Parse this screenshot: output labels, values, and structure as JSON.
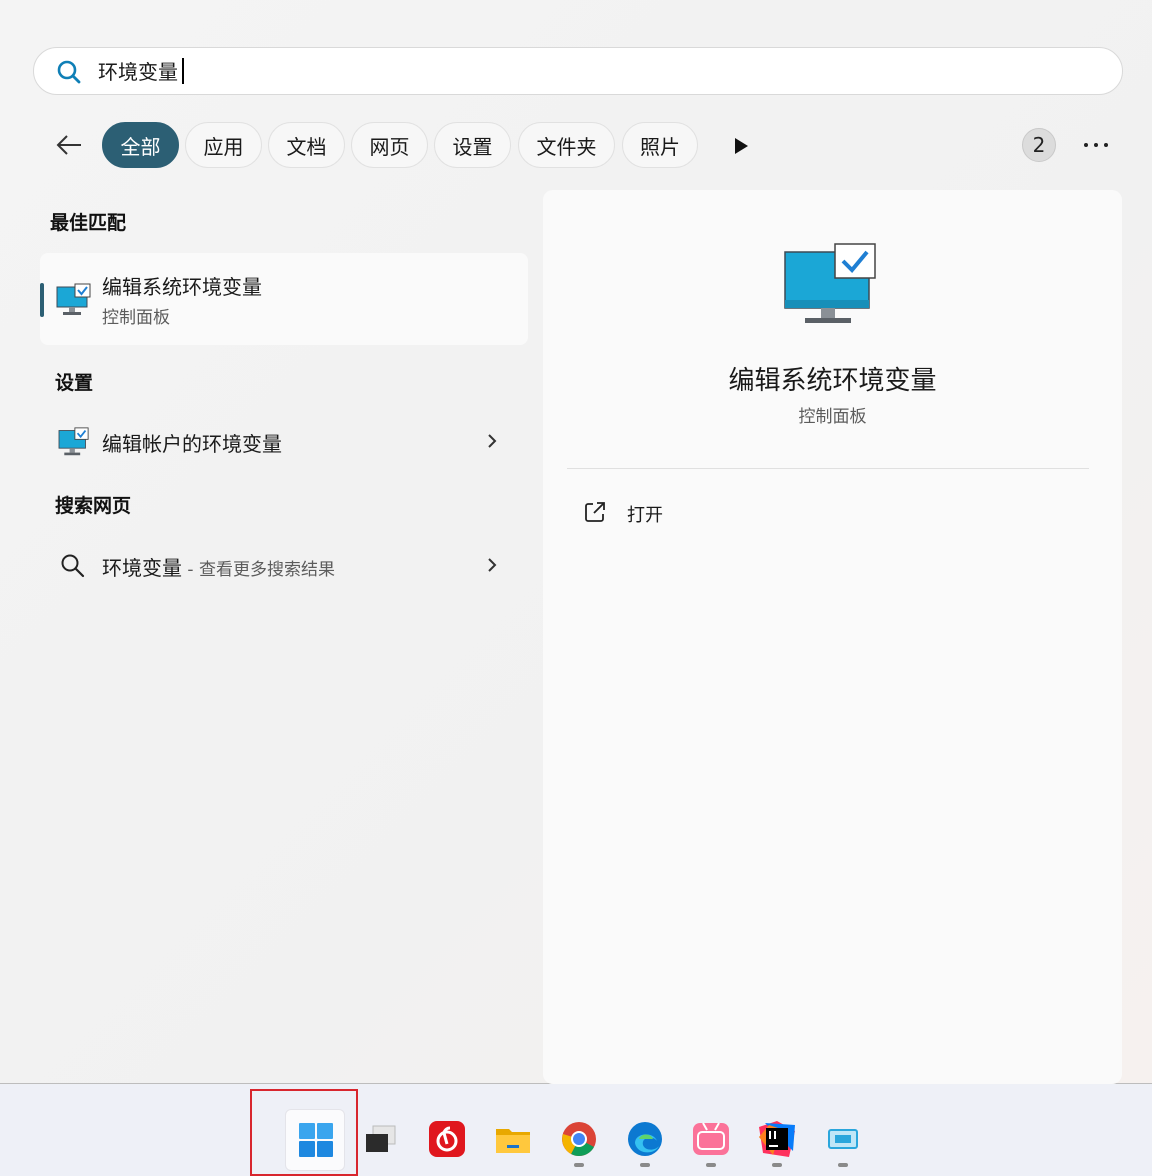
{
  "search": {
    "query": "环境变量"
  },
  "filters": {
    "chips": [
      {
        "label": "全部",
        "active": true
      },
      {
        "label": "应用",
        "active": false
      },
      {
        "label": "文档",
        "active": false
      },
      {
        "label": "网页",
        "active": false
      },
      {
        "label": "设置",
        "active": false
      },
      {
        "label": "文件夹",
        "active": false
      },
      {
        "label": "照片",
        "active": false
      }
    ],
    "badge": "2"
  },
  "results": {
    "best_match_title": "最佳匹配",
    "best_match": {
      "title": "编辑系统环境变量",
      "subtitle": "控制面板"
    },
    "settings_title": "设置",
    "settings_item": {
      "label": "编辑帐户的环境变量"
    },
    "web_title": "搜索网页",
    "web_item": {
      "query": "环境变量",
      "hint": " - 查看更多搜索结果"
    }
  },
  "preview": {
    "title": "编辑系统环境变量",
    "subtitle": "控制面板",
    "open_label": "打开"
  },
  "taskbar": {
    "apps": [
      "start-icon",
      "task-view-icon",
      "netease-music-icon",
      "file-explorer-icon",
      "chrome-icon",
      "edge-icon",
      "bilibili-icon",
      "intellij-idea-icon",
      "remote-app-icon"
    ]
  },
  "colors": {
    "accent": "#2c5f74",
    "highlight_box": "#d8262e"
  }
}
